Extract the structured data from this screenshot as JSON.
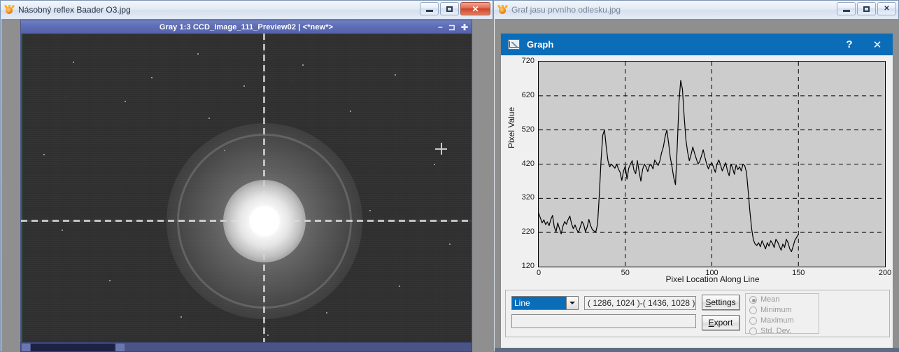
{
  "image_window": {
    "title": "Násobný reflex Baader O3.jpg",
    "icon": "sun-app-icon",
    "buttons": {
      "minimize": "minimize-icon",
      "restore": "restore-icon",
      "close": "✕"
    },
    "mdi_child": {
      "title": "Gray 1:3 CCD_Image_111_Preview02 | <*new*>",
      "minimize": "−",
      "restore": "⊐",
      "close": "✚"
    },
    "content": "bright star with diffraction spikes and halo reflection"
  },
  "graph_window": {
    "title": "Graf jasu prvního odlesku.jpg",
    "icon": "sun-app-icon",
    "buttons": {
      "minimize": "minimize-icon",
      "restore": "restore-icon",
      "close": "✕"
    },
    "dialog": {
      "title": "Graph",
      "icon": "graph-icon",
      "help": "?",
      "close": "✕"
    },
    "controls": {
      "mode_selected": "Line",
      "mode_options": [
        "Line"
      ],
      "coordinates": "( 1286, 1024 )-( 1436, 1028 )",
      "text_value": "",
      "settings_label_prefix": "S",
      "settings_label_rest": "ettings",
      "export_label_prefix": "E",
      "export_label_rest": "xport",
      "stats": [
        {
          "label": "Mean",
          "selected": true
        },
        {
          "label": "Minimum",
          "selected": false
        },
        {
          "label": "Maximum",
          "selected": false
        },
        {
          "label": "Std. Dev.",
          "selected": false
        }
      ]
    }
  },
  "chart_data": {
    "type": "line",
    "title": "",
    "xlabel": "Pixel Location Along Line",
    "ylabel": "Pixel Value",
    "xlim": [
      0,
      200
    ],
    "ylim": [
      120,
      720
    ],
    "xticks": [
      0,
      50,
      100,
      150,
      200
    ],
    "yticks": [
      120,
      220,
      320,
      420,
      520,
      620,
      720
    ],
    "grid": true,
    "legend": "none",
    "plot_background": "#cccccc",
    "line_color": "#000000",
    "x": [
      0,
      1,
      2,
      3,
      4,
      5,
      6,
      7,
      8,
      9,
      10,
      11,
      12,
      13,
      14,
      15,
      16,
      17,
      18,
      19,
      20,
      21,
      22,
      23,
      24,
      25,
      26,
      27,
      28,
      29,
      30,
      31,
      32,
      33,
      34,
      35,
      36,
      37,
      38,
      39,
      40,
      41,
      42,
      43,
      44,
      45,
      46,
      47,
      48,
      49,
      50,
      51,
      52,
      53,
      54,
      55,
      56,
      57,
      58,
      59,
      60,
      61,
      62,
      63,
      64,
      65,
      66,
      67,
      68,
      69,
      70,
      71,
      72,
      73,
      74,
      75,
      76,
      77,
      78,
      79,
      80,
      81,
      82,
      83,
      84,
      85,
      86,
      87,
      88,
      89,
      90,
      91,
      92,
      93,
      94,
      95,
      96,
      97,
      98,
      99,
      100,
      101,
      102,
      103,
      104,
      105,
      106,
      107,
      108,
      109,
      110,
      111,
      112,
      113,
      114,
      115,
      116,
      117,
      118,
      119,
      120,
      121,
      122,
      123,
      124,
      125,
      126,
      127,
      128,
      129,
      130,
      131,
      132,
      133,
      134,
      135,
      136,
      137,
      138,
      139,
      140,
      141,
      142,
      143,
      144,
      145,
      146,
      147,
      148,
      149,
      150
    ],
    "y": [
      276,
      262,
      248,
      257,
      243,
      251,
      240,
      258,
      270,
      236,
      222,
      248,
      231,
      216,
      238,
      252,
      244,
      258,
      268,
      245,
      231,
      242,
      228,
      220,
      236,
      252,
      243,
      222,
      236,
      258,
      240,
      228,
      224,
      222,
      244,
      330,
      430,
      505,
      520,
      470,
      430,
      412,
      420,
      414,
      408,
      420,
      406,
      396,
      372,
      400,
      414,
      376,
      408,
      420,
      430,
      402,
      392,
      430,
      398,
      370,
      404,
      420,
      412,
      398,
      416,
      418,
      406,
      432,
      424,
      416,
      430,
      454,
      470,
      500,
      520,
      482,
      440,
      412,
      380,
      360,
      470,
      600,
      665,
      640,
      560,
      492,
      455,
      430,
      448,
      470,
      452,
      436,
      420,
      428,
      444,
      462,
      440,
      420,
      406,
      418,
      424,
      410,
      396,
      420,
      432,
      418,
      400,
      412,
      424,
      400,
      386,
      420,
      408,
      390,
      418,
      404,
      412,
      400,
      420,
      415,
      396,
      340,
      280,
      230,
      198,
      186,
      182,
      190,
      178,
      196,
      184,
      172,
      190,
      180,
      196,
      188,
      176,
      200,
      192,
      180,
      168,
      186,
      176,
      200,
      190,
      172,
      164,
      180,
      198,
      206,
      214
    ],
    "notes": "Baseline ~230-270 for x<33, step up to plateau ~400-430 with peaks at x≈37 (520) and x≈82 (665), step down at x≈122 to baseline ~180-200, data ends at x=150"
  }
}
